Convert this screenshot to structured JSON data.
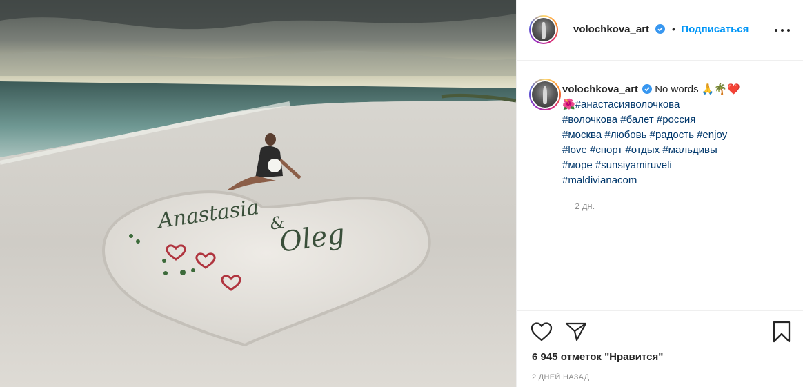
{
  "post": {
    "username": "volochkova_art",
    "follow_label": "Подписаться",
    "separator": "•",
    "verified_icon": "verified-badge-icon",
    "caption_text": "No words",
    "caption_emoji": "🙏🌴❤️",
    "flower_emoji": "🌺",
    "hashtags": {
      "h1": "#анастасияволочкова",
      "h2": "#волочкова",
      "h3": "#балет",
      "h4": "#россия",
      "h5": "#москва",
      "h6": "#любовь",
      "h7": "#радость",
      "h8": "#enjoy",
      "h9": "#love",
      "h10": "#спорт",
      "h11": "#отдых",
      "h12": "#мальдивы",
      "h13": "#море",
      "h14": "#sunsiyamiruveli",
      "h15": "#maldivianacom"
    },
    "caption_time": "2 дн.",
    "likes": "6 945 отметок \"Нравится\"",
    "date": "2 ДНЕЙ НАЗАД"
  },
  "photo": {
    "sand_writing_name1": "Anastasia",
    "sand_writing_and": "&",
    "sand_writing_name2": "Oleg"
  },
  "colors": {
    "accent": "#0095f6",
    "text": "#262626",
    "muted": "#8e8e8e",
    "hashtag": "#00376b"
  }
}
